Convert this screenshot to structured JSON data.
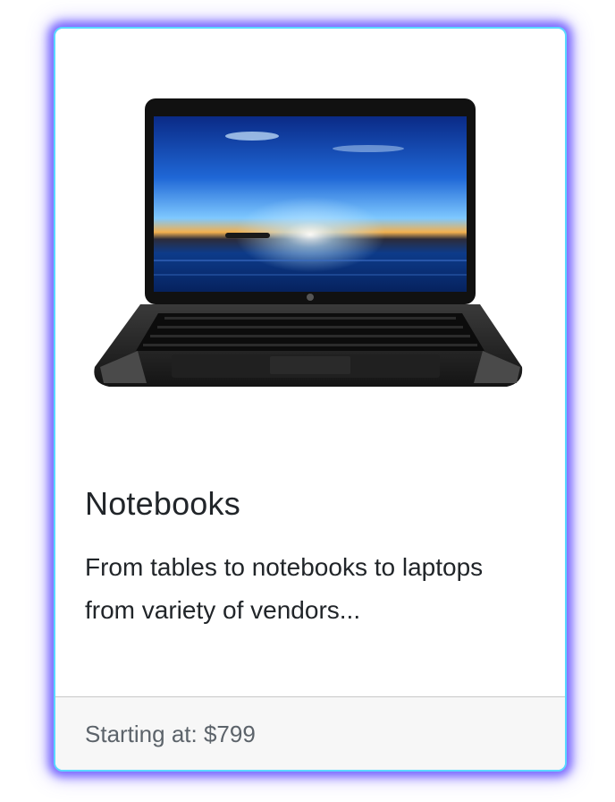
{
  "card": {
    "image": {
      "icon": "laptop-image",
      "alt": ""
    },
    "title": "Notebooks",
    "text": "From tables to notebooks to laptops from variety of vendors...",
    "footer": "Starting at: $799"
  },
  "colors": {
    "border": "#5ad8ff",
    "glow": "#5a46ff",
    "footer_bg": "#f7f7f7",
    "text": "#212529",
    "muted": "#5c636a"
  }
}
